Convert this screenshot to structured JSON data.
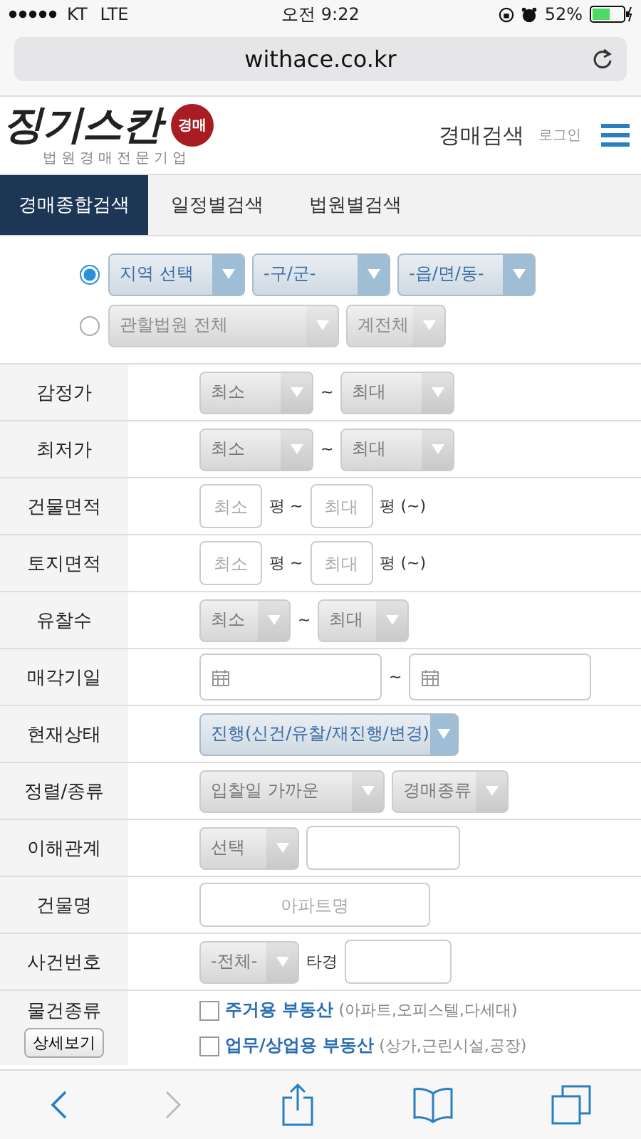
{
  "status_bar": {
    "carrier": "KT",
    "network": "LTE",
    "time": "오전 9:22",
    "battery": "52%"
  },
  "address_bar": {
    "url": "withace.co.kr"
  },
  "header": {
    "logo": "징기스칸",
    "logo_badge": "경매",
    "logo_tagline": "법원경매전문기업",
    "nav_link": "경매검색",
    "login": "로그인"
  },
  "tabs": [
    {
      "label": "경매종합검색",
      "selected": true
    },
    {
      "label": "일정별검색",
      "selected": false
    },
    {
      "label": "법원별검색",
      "selected": false
    }
  ],
  "location_options": [
    {
      "selected": true,
      "selects": [
        {
          "value": "지역 선택",
          "highlighted": true,
          "disabled": false
        },
        {
          "value": "-구/군-",
          "highlighted": true,
          "disabled": false
        },
        {
          "value": "-읍/면/동-",
          "highlighted": true,
          "disabled": false
        }
      ]
    },
    {
      "selected": false,
      "selects": [
        {
          "value": "관할법원 전체",
          "highlighted": false,
          "disabled": true
        },
        {
          "value": "계전체",
          "highlighted": false,
          "disabled": true
        }
      ]
    }
  ],
  "rows": [
    {
      "label": "감정가",
      "controls": [
        {
          "kind": "select",
          "value": "최소"
        },
        {
          "kind": "text",
          "text": "~"
        },
        {
          "kind": "select",
          "value": "최대"
        }
      ]
    },
    {
      "label": "최저가",
      "controls": [
        {
          "kind": "select",
          "value": "최소"
        },
        {
          "kind": "text",
          "text": "~"
        },
        {
          "kind": "select",
          "value": "최대"
        }
      ]
    },
    {
      "label": "건물면적",
      "controls": [
        {
          "kind": "input",
          "placeholder": "최소"
        },
        {
          "kind": "text",
          "text": "평 ~"
        },
        {
          "kind": "input",
          "placeholder": "최대"
        },
        {
          "kind": "text",
          "text": "평 (~)"
        }
      ]
    },
    {
      "label": "토지면적",
      "controls": [
        {
          "kind": "input",
          "placeholder": "최소"
        },
        {
          "kind": "text",
          "text": "평 ~"
        },
        {
          "kind": "input",
          "placeholder": "최대"
        },
        {
          "kind": "text",
          "text": "평 (~)"
        }
      ]
    },
    {
      "label": "유찰수",
      "controls": [
        {
          "kind": "select",
          "value": "최소"
        },
        {
          "kind": "text",
          "text": "~"
        },
        {
          "kind": "select",
          "value": "최대"
        }
      ]
    },
    {
      "label": "매각기일",
      "controls": [
        {
          "kind": "date"
        },
        {
          "kind": "text",
          "text": "~"
        },
        {
          "kind": "date"
        }
      ]
    },
    {
      "label": "현재상태",
      "controls": [
        {
          "kind": "select",
          "value": "진행(신건/유찰/재진행/변경)",
          "highlighted": true
        }
      ]
    },
    {
      "label": "정렬/종류",
      "controls": [
        {
          "kind": "select",
          "value": "입찰일 가까운"
        },
        {
          "kind": "select",
          "value": "경매종류"
        }
      ]
    },
    {
      "label": "이해관계",
      "controls": [
        {
          "kind": "select",
          "value": "선택"
        },
        {
          "kind": "input"
        }
      ]
    },
    {
      "label": "건물명",
      "controls": [
        {
          "kind": "input",
          "placeholder": "아파트명"
        }
      ]
    },
    {
      "label": "사건번호",
      "controls": [
        {
          "kind": "select",
          "value": "-전체-"
        },
        {
          "kind": "text",
          "text": "타경"
        },
        {
          "kind": "input"
        }
      ]
    }
  ],
  "property_type": {
    "label": "물건종류",
    "button": "상세보기",
    "options": [
      {
        "title": "주거용 부동산",
        "detail": "(아파트,오피스텔,다세대)",
        "checked": false
      },
      {
        "title": "업무/상업용 부동산",
        "detail": "(상가,근린시설,공장)",
        "checked": false
      }
    ]
  },
  "browser_toolbar": {
    "back_enabled": true,
    "forward_enabled": false
  }
}
